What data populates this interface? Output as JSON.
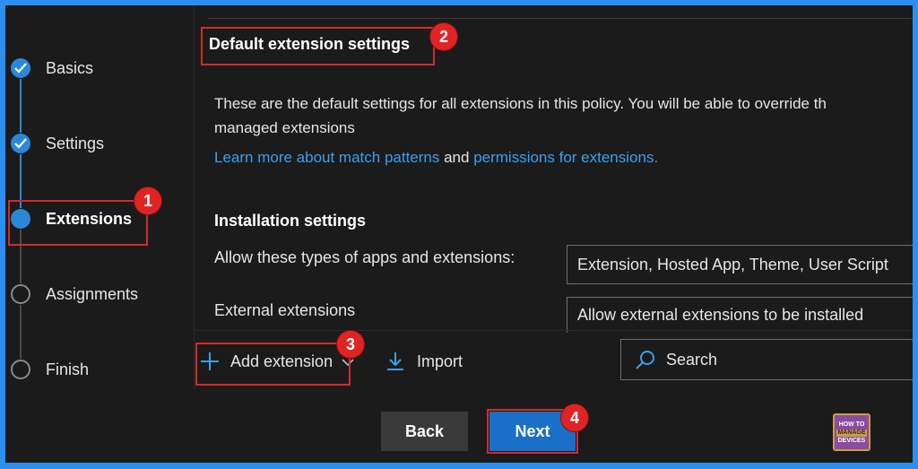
{
  "wizard": {
    "steps": [
      {
        "label": "Basics",
        "state": "done"
      },
      {
        "label": "Settings",
        "state": "done"
      },
      {
        "label": "Extensions",
        "state": "current"
      },
      {
        "label": "Assignments",
        "state": "todo"
      },
      {
        "label": "Finish",
        "state": "todo"
      }
    ]
  },
  "main": {
    "title": "Default extension settings",
    "description": "These are the default settings for all extensions in this policy. You will be able to override th",
    "description_line2": "managed extensions",
    "learn_link_1": "Learn more about match patterns",
    "and_text": " and ",
    "learn_link_2": "permissions for extensions.",
    "section": "Installation settings",
    "fields": [
      {
        "label": "Allow these types of apps and extensions:",
        "value": "Extension, Hosted App, Theme, User Script"
      },
      {
        "label": "External extensions",
        "value": "Allow external extensions to be installed"
      }
    ]
  },
  "toolbar": {
    "add_label": "Add extension",
    "import_label": "Import",
    "search_placeholder": "Search"
  },
  "footer": {
    "back_label": "Back",
    "next_label": "Next"
  },
  "annotations": [
    "1",
    "2",
    "3",
    "4"
  ],
  "logo": {
    "line1": "HOW TO",
    "line2": "MANAGE",
    "line3": "DEVICES"
  },
  "colors": {
    "accent": "#2b88d8",
    "link": "#3a9ff0",
    "callout": "#d42a2a",
    "frame": "#2b8ff0"
  }
}
